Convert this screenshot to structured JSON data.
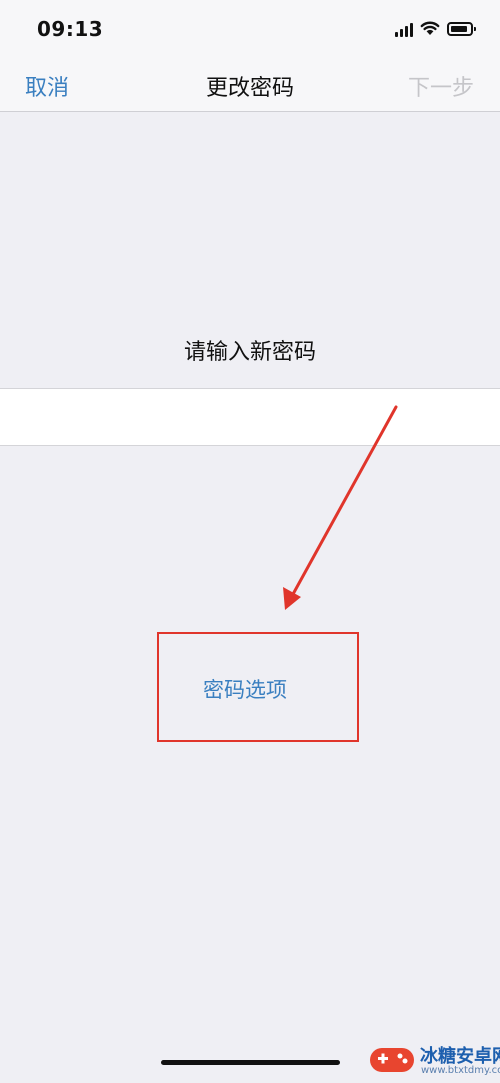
{
  "status_bar": {
    "time": "09:13"
  },
  "nav": {
    "cancel_label": "取消",
    "title": "更改密码",
    "next_label": "下一步"
  },
  "content": {
    "prompt": "请输入新密码",
    "options_label": "密码选项"
  },
  "colors": {
    "accent": "#3a7fc0",
    "disabled": "#c5c5c9",
    "annotation": "#e0352b",
    "background": "#efeff4"
  },
  "watermark": {
    "name": "冰糖安卓网",
    "url": "www.btxtdmy.com"
  }
}
